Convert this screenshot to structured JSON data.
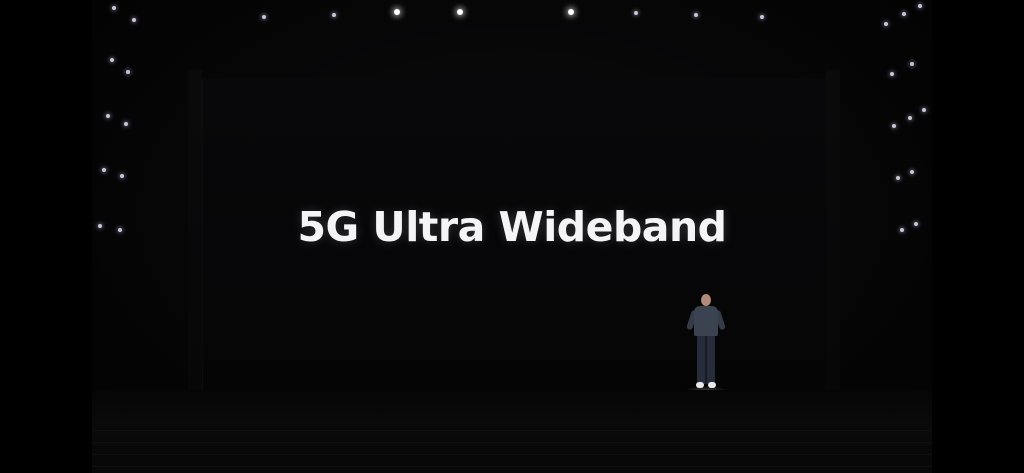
{
  "scene": {
    "headline": "5G Ultra Wideband",
    "colors": {
      "background": "#000000",
      "headline_text": "#f4f4f6",
      "stage_light": "#ffffff"
    }
  }
}
